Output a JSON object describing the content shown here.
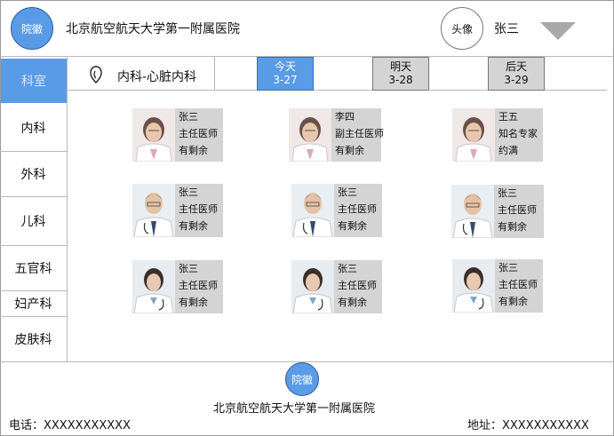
{
  "header": {
    "logo_label": "院徽",
    "hospital_name": "北京航空航天大学第一附属医院",
    "avatar_label": "头像",
    "username": "张三"
  },
  "sidebar": {
    "title": "科室",
    "items": [
      {
        "label": "内科"
      },
      {
        "label": "外科"
      },
      {
        "label": "儿科"
      },
      {
        "label": "五官科"
      },
      {
        "label": "妇产科"
      },
      {
        "label": "皮肤科"
      }
    ]
  },
  "toolbar": {
    "current_department": "内科-心脏内科",
    "days": [
      {
        "name": "今天",
        "date": "3-27"
      },
      {
        "name": "明天",
        "date": "3-28"
      },
      {
        "name": "后天",
        "date": "3-29"
      }
    ]
  },
  "doctors": [
    {
      "name": "张三",
      "title": "主任医师",
      "status": "有剩余"
    },
    {
      "name": "李四",
      "title": "副主任医师",
      "status": "有剩余"
    },
    {
      "name": "王五",
      "title": "知名专家",
      "status": "约满"
    },
    {
      "name": "张三",
      "title": "主任医师",
      "status": "有剩余"
    },
    {
      "name": "张三",
      "title": "主任医师",
      "status": "有剩余"
    },
    {
      "name": "张三",
      "title": "主任医师",
      "status": "有剩余"
    },
    {
      "name": "张三",
      "title": "主任医师",
      "status": "有剩余"
    },
    {
      "name": "张三",
      "title": "主任医师",
      "status": "有剩余"
    },
    {
      "name": "张三",
      "title": "主任医师",
      "status": "有剩余"
    }
  ],
  "footer": {
    "logo_label": "院徽",
    "hospital_name": "北京航空航天大学第一附属医院",
    "phone": "电话：XXXXXXXXXXX",
    "address": "地址：XXXXXXXXXXX"
  },
  "colors": {
    "accent": "#5a9be8",
    "inactive_tab": "#d4d4d4"
  }
}
